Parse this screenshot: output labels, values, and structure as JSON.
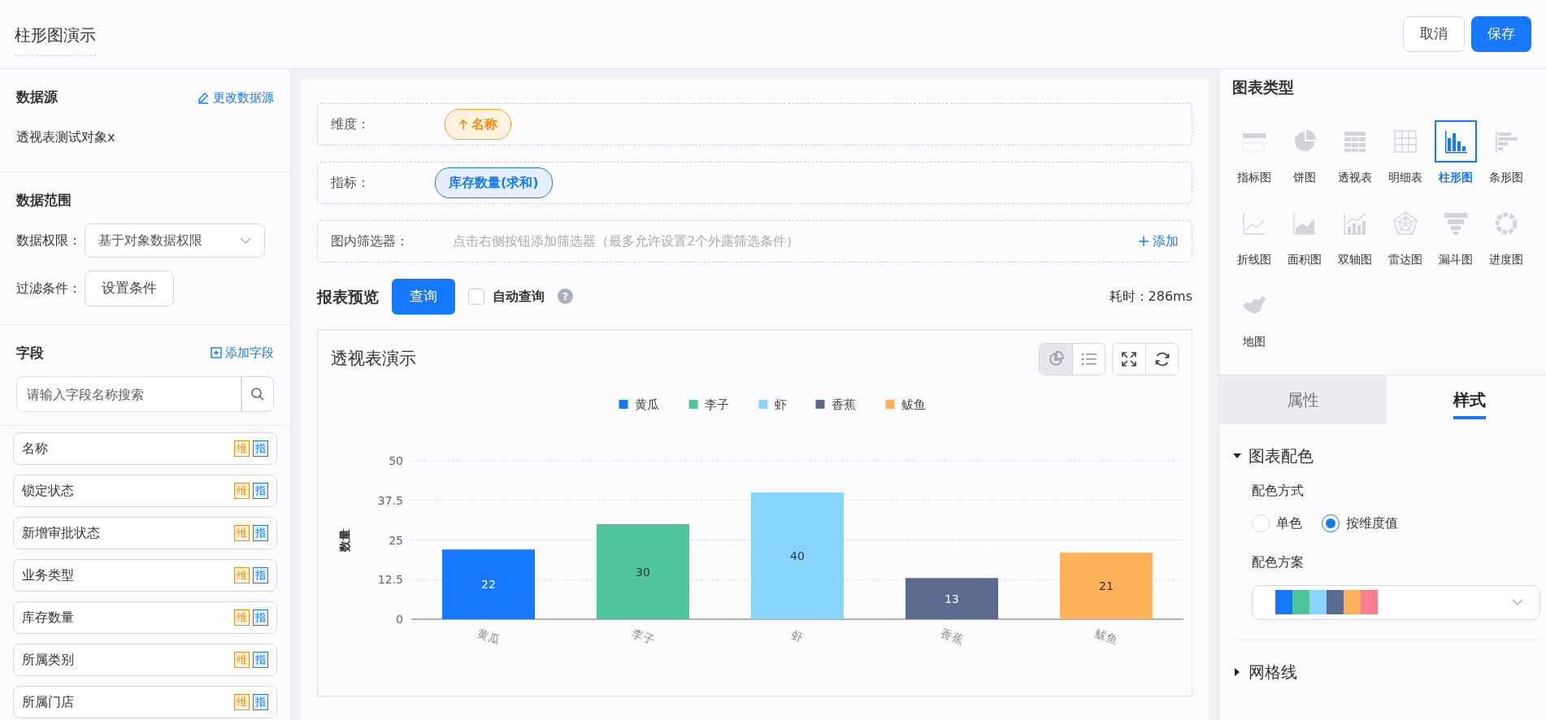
{
  "header": {
    "title": "柱形图演示",
    "buttons": [
      {
        "label": "取消",
        "kind": "secondary"
      },
      {
        "label": "保存",
        "kind": "primary"
      }
    ]
  },
  "data_source": {
    "title": "数据源",
    "action": "更改数据源",
    "value": "透视表测试对象x"
  },
  "data_range": {
    "title": "数据范围",
    "rows": [
      {
        "label": "数据权限：",
        "kind": "select",
        "value": "基于对象数据权限"
      },
      {
        "label": "过滤条件：",
        "kind": "button",
        "value": "设置条件"
      }
    ]
  },
  "fields": {
    "title": "字段",
    "action": "添加字段",
    "search_placeholder": "请输入字段名称搜索",
    "items": [
      {
        "name": "名称",
        "dimension_tag": "维",
        "measure_tag": "指"
      },
      {
        "name": "锁定状态",
        "dimension_tag": "维",
        "measure_tag": "指"
      },
      {
        "name": "新增审批状态",
        "dimension_tag": "维",
        "measure_tag": "指"
      },
      {
        "name": "业务类型",
        "dimension_tag": "维",
        "measure_tag": "指"
      },
      {
        "name": "库存数量",
        "dimension_tag": "维",
        "measure_tag": "指"
      },
      {
        "name": "所属类别",
        "dimension_tag": "维",
        "measure_tag": "指"
      },
      {
        "name": "所属门店",
        "dimension_tag": "维",
        "measure_tag": "指"
      }
    ]
  },
  "config": {
    "rows": [
      {
        "label": "维度：",
        "kind": "dimension",
        "chips": [
          "名称"
        ]
      },
      {
        "label": "指标：",
        "kind": "measure",
        "chips": [
          "库存数量(求和)"
        ]
      },
      {
        "label": "图内筛选器：",
        "kind": "filter",
        "hint": "点击右侧按钮添加筛选器（最多允许设置2个外露筛选条件）",
        "action": "添加"
      }
    ]
  },
  "preview": {
    "title": "报表预览",
    "query_button": "查询",
    "auto_query": {
      "label": "自动查询",
      "checked": false
    },
    "help": "?",
    "elapsed": "耗时：286ms",
    "card": {
      "title": "透视表演示",
      "view_toggle": [
        {
          "kind": "chart",
          "selected": true
        },
        {
          "kind": "list",
          "selected": false
        }
      ],
      "tools": [
        {
          "kind": "fullscreen"
        },
        {
          "kind": "refresh"
        }
      ],
      "chart_data": {
        "type": "bar",
        "ylabel": "数量",
        "categories": [
          "黄瓜",
          "李子",
          "虾",
          "香蕉",
          "鲅鱼"
        ],
        "grid": true,
        "legend": true,
        "data_labels": true,
        "ylim": [
          0,
          50
        ],
        "yticks": [
          0,
          12.5,
          25,
          37.5,
          50
        ],
        "series": [
          {
            "name": "黄瓜",
            "color": "#1677ff",
            "values": [
              22,
              null,
              null,
              null,
              null
            ]
          },
          {
            "name": "李子",
            "color": "#4fc59b",
            "values": [
              null,
              30,
              null,
              null,
              null
            ]
          },
          {
            "name": "虾",
            "color": "#86d4ff",
            "values": [
              null,
              null,
              40,
              null,
              null
            ]
          },
          {
            "name": "香蕉",
            "color": "#5b6a8f",
            "values": [
              null,
              null,
              null,
              13,
              null
            ]
          },
          {
            "name": "鲅鱼",
            "color": "#fdb259",
            "values": [
              null,
              null,
              null,
              null,
              21
            ]
          }
        ]
      }
    }
  },
  "chart_type_panel": {
    "title": "图表类型",
    "types": [
      {
        "label": "指标图",
        "kind": "indicator",
        "selected": false
      },
      {
        "label": "饼图",
        "kind": "pie",
        "selected": false
      },
      {
        "label": "透视表",
        "kind": "pivot",
        "selected": false
      },
      {
        "label": "明细表",
        "kind": "table",
        "selected": false
      },
      {
        "label": "柱形图",
        "kind": "column",
        "selected": true
      },
      {
        "label": "条形图",
        "kind": "bar",
        "selected": false
      },
      {
        "label": "折线图",
        "kind": "line",
        "selected": false
      },
      {
        "label": "面积图",
        "kind": "area",
        "selected": false
      },
      {
        "label": "双轴图",
        "kind": "dual",
        "selected": false
      },
      {
        "label": "雷达图",
        "kind": "radar",
        "selected": false
      },
      {
        "label": "漏斗图",
        "kind": "funnel",
        "selected": false
      },
      {
        "label": "进度图",
        "kind": "progress",
        "selected": false
      },
      {
        "label": "地图",
        "kind": "map",
        "selected": false
      }
    ]
  },
  "tabs": [
    {
      "label": "属性",
      "selected": false
    },
    {
      "label": "样式",
      "selected": true
    }
  ],
  "style_sections": [
    {
      "title": "图表配色",
      "expanded": true,
      "color_mode": {
        "label": "配色方式",
        "options": [
          {
            "label": "单色",
            "selected": false
          },
          {
            "label": "按维度值",
            "selected": true
          }
        ]
      },
      "palette": {
        "label": "配色方案",
        "colors": [
          {
            "color": "#1677ff"
          },
          {
            "color": "#4fc59b"
          },
          {
            "color": "#86d4ff"
          },
          {
            "color": "#5b6a8f"
          },
          {
            "color": "#fdb259"
          },
          {
            "color": "#f77f8f"
          }
        ]
      }
    },
    {
      "title": "网格线",
      "expanded": false
    }
  ]
}
